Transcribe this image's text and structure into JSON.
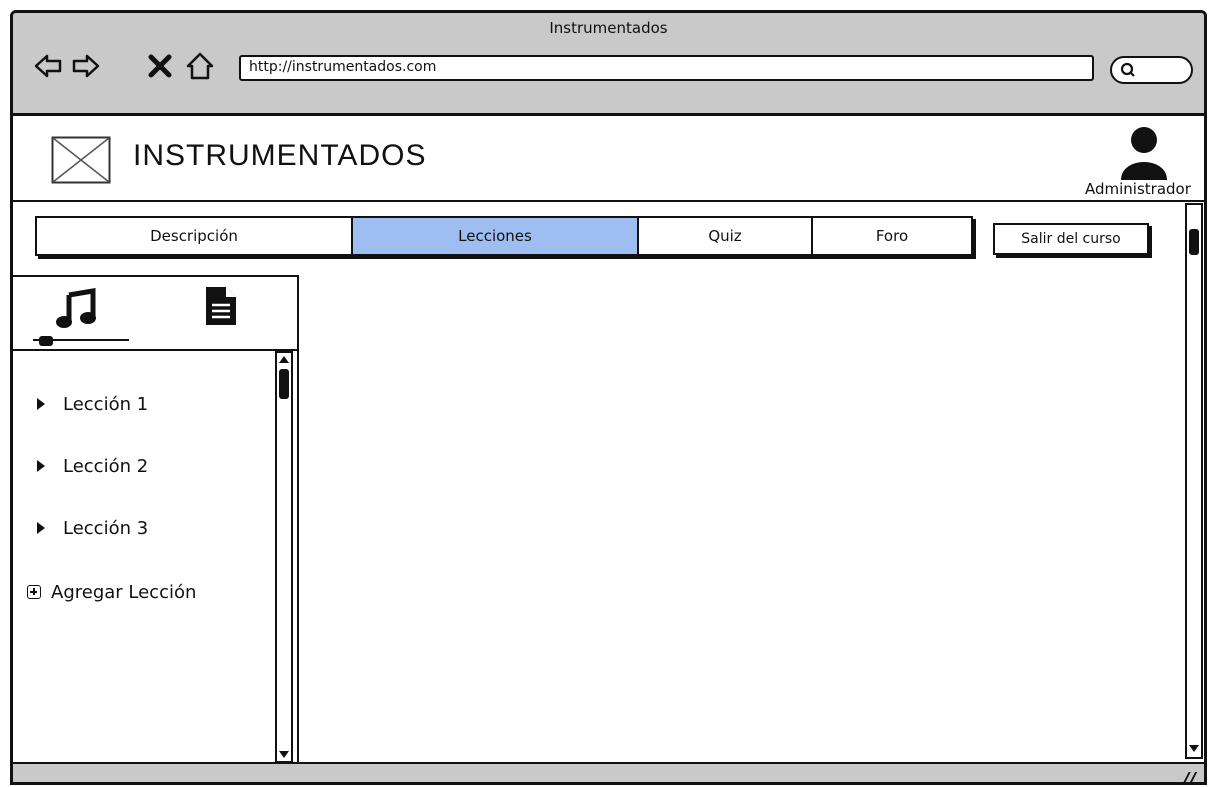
{
  "browser": {
    "window_title": "Instrumentados",
    "url": "http://instrumentados.com",
    "icons": [
      "back-arrow-icon",
      "forward-arrow-icon",
      "close-icon",
      "home-icon",
      "search-icon"
    ]
  },
  "header": {
    "site_title": "INSTRUMENTADOS",
    "user_label": "Administrador"
  },
  "tabs": [
    {
      "label": "Descripción",
      "active": false
    },
    {
      "label": "Lecciones",
      "active": true
    },
    {
      "label": "Quiz",
      "active": false
    },
    {
      "label": "Foro",
      "active": false
    }
  ],
  "exit_button": "Salir del curso",
  "sidebar": {
    "icons": [
      "music-note-icon",
      "document-icon"
    ],
    "lessons": [
      "Lección 1",
      "Lección 2",
      "Lección 3"
    ],
    "add_lesson": "Agregar Lección"
  },
  "colors": {
    "chrome_gray": "#c9c9c9",
    "active_tab": "#9ebdf0"
  }
}
